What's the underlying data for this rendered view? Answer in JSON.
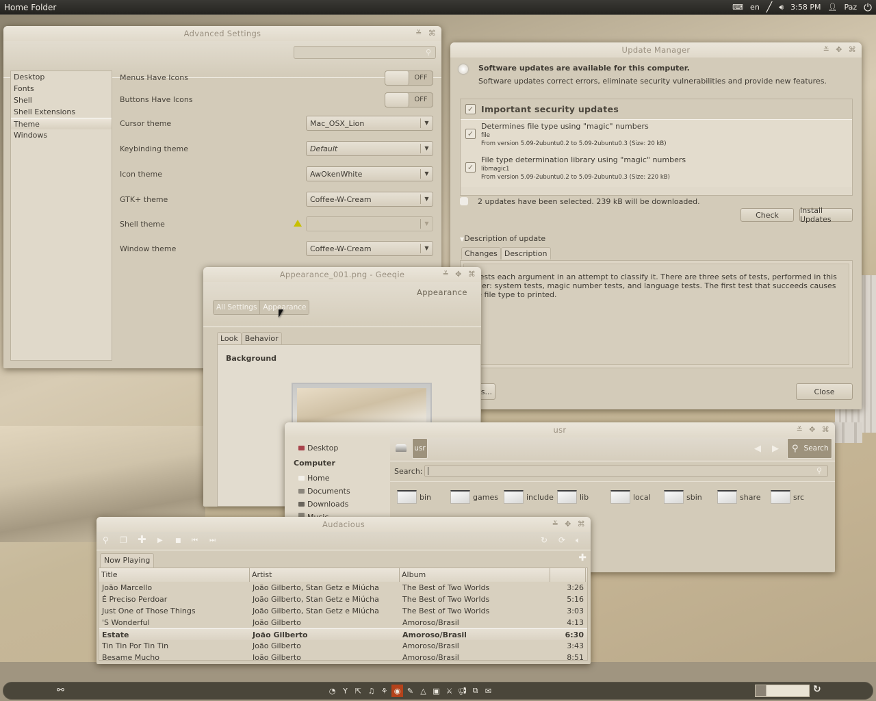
{
  "topbar": {
    "app_title": "Home Folder",
    "keyboard_layout": "en",
    "clock": "3:58 PM",
    "user": "Paz",
    "icons": [
      "keyboard-icon",
      "network-icon",
      "volume-icon",
      "user-icon",
      "power-icon"
    ]
  },
  "advanced_settings": {
    "title": "Advanced Settings",
    "search_placeholder": "",
    "sidebar": [
      "Desktop",
      "Fonts",
      "Shell",
      "Shell Extensions",
      "Theme",
      "Windows"
    ],
    "selected": "Theme",
    "rows": {
      "menus_have_icons": {
        "label": "Menus Have Icons",
        "value": "OFF"
      },
      "buttons_have_icons": {
        "label": "Buttons Have Icons",
        "value": "OFF"
      },
      "cursor_theme": {
        "label": "Cursor theme",
        "value": "Mac_OSX_Lion"
      },
      "keybinding_theme": {
        "label": "Keybinding theme",
        "value": "Default"
      },
      "icon_theme": {
        "label": "Icon theme",
        "value": "AwOkenWhite"
      },
      "gtk_theme": {
        "label": "GTK+ theme",
        "value": "Coffee-W-Cream"
      },
      "shell_theme": {
        "label": "Shell theme",
        "value": ""
      },
      "window_theme": {
        "label": "Window theme",
        "value": "Coffee-W-Cream"
      }
    }
  },
  "update_manager": {
    "title": "Update Manager",
    "heading": "Software updates are available for this computer.",
    "subheading": "Software updates correct errors, eliminate security vulnerabilities and provide new features.",
    "group": "Important security updates",
    "updates": [
      {
        "name": "Determines file type using \"magic\" numbers",
        "package": "file",
        "version": "From version 5.09-2ubuntu0.2 to 5.09-2ubuntu0.3 (Size: 20 kB)",
        "checked": true
      },
      {
        "name": "File type determination library using \"magic\" numbers",
        "package": "libmagic1",
        "version": "From version 5.09-2ubuntu0.2 to 5.09-2ubuntu0.3 (Size: 220 kB)",
        "checked": true
      }
    ],
    "summary": "2 updates have been selected. 239 kB will be downloaded.",
    "check_label": "Check",
    "install_label": "Install Updates",
    "description_expander": "Description of update",
    "tabs": [
      "Changes",
      "Description"
    ],
    "active_tab": "Description",
    "description_text": "e tests each argument in an attempt to classify it. There are three sets of tests, performed in this order: system tests, magic number tests, and language tests. The first test that succeeds causes the file type to printed.",
    "settings_label": "gs...",
    "close_label": "Close"
  },
  "geeqie": {
    "title": "Appearance_001.png - Geeqie",
    "page_title": "Appearance",
    "breadcrumbs": [
      "All Settings",
      "Appearance"
    ],
    "tabs": [
      "Look",
      "Behavior"
    ],
    "active_tab": "Look",
    "section": "Background"
  },
  "file_manager": {
    "title": "usr",
    "sidebar": {
      "desktop": "Desktop",
      "computer_heading": "Computer",
      "home": "Home",
      "documents": "Documents",
      "downloads": "Downloads",
      "music": "Music"
    },
    "path_button": "usr",
    "search_button": "Search",
    "search_label": "Search:",
    "search_value": "",
    "folders": [
      "bin",
      "games",
      "include",
      "lib",
      "local",
      "sbin",
      "share",
      "src"
    ]
  },
  "audacious": {
    "title": "Audacious",
    "playlist_tab": "Now Playing",
    "columns": [
      "Title",
      "Artist",
      "Album",
      ""
    ],
    "rows": [
      {
        "title": "João Marcello",
        "artist": "João Gilberto, Stan Getz e Miúcha",
        "album": "The Best of Two Worlds",
        "time": "3:26",
        "current": false
      },
      {
        "title": "É Preciso Perdoar",
        "artist": "João Gilberto, Stan Getz e Miúcha",
        "album": "The Best of Two Worlds",
        "time": "5:16",
        "current": false
      },
      {
        "title": "Just One of Those Things",
        "artist": "João Gilberto, Stan Getz e Miúcha",
        "album": "The Best of Two Worlds",
        "time": "3:03",
        "current": false
      },
      {
        "title": "'S Wonderful",
        "artist": "João Gilberto",
        "album": "Amoroso/Brasil",
        "time": "4:13",
        "current": false
      },
      {
        "title": "Estate",
        "artist": "João Gilberto",
        "album": "Amoroso/Brasil",
        "time": "6:30",
        "current": true
      },
      {
        "title": "Tin Tin Por Tin Tin",
        "artist": "João Gilberto",
        "album": "Amoroso/Brasil",
        "time": "3:43",
        "current": false
      },
      {
        "title": "Besame Mucho",
        "artist": "João Gilberto",
        "album": "Amoroso/Brasil",
        "time": "8:51",
        "current": false
      }
    ]
  },
  "dock": {
    "active_color": "#b5421a",
    "launchers": [
      "firefox",
      "yakuake",
      "export",
      "music-player",
      "stork",
      "audacious",
      "gimp-brush",
      "vlc",
      "terminal",
      "gimp",
      "announce",
      "remote-desktop",
      "chat"
    ]
  },
  "colors": {
    "window_bg": "#d3cbb9",
    "panel_bg": "#24231f",
    "dock_bg": "#4a463a"
  }
}
